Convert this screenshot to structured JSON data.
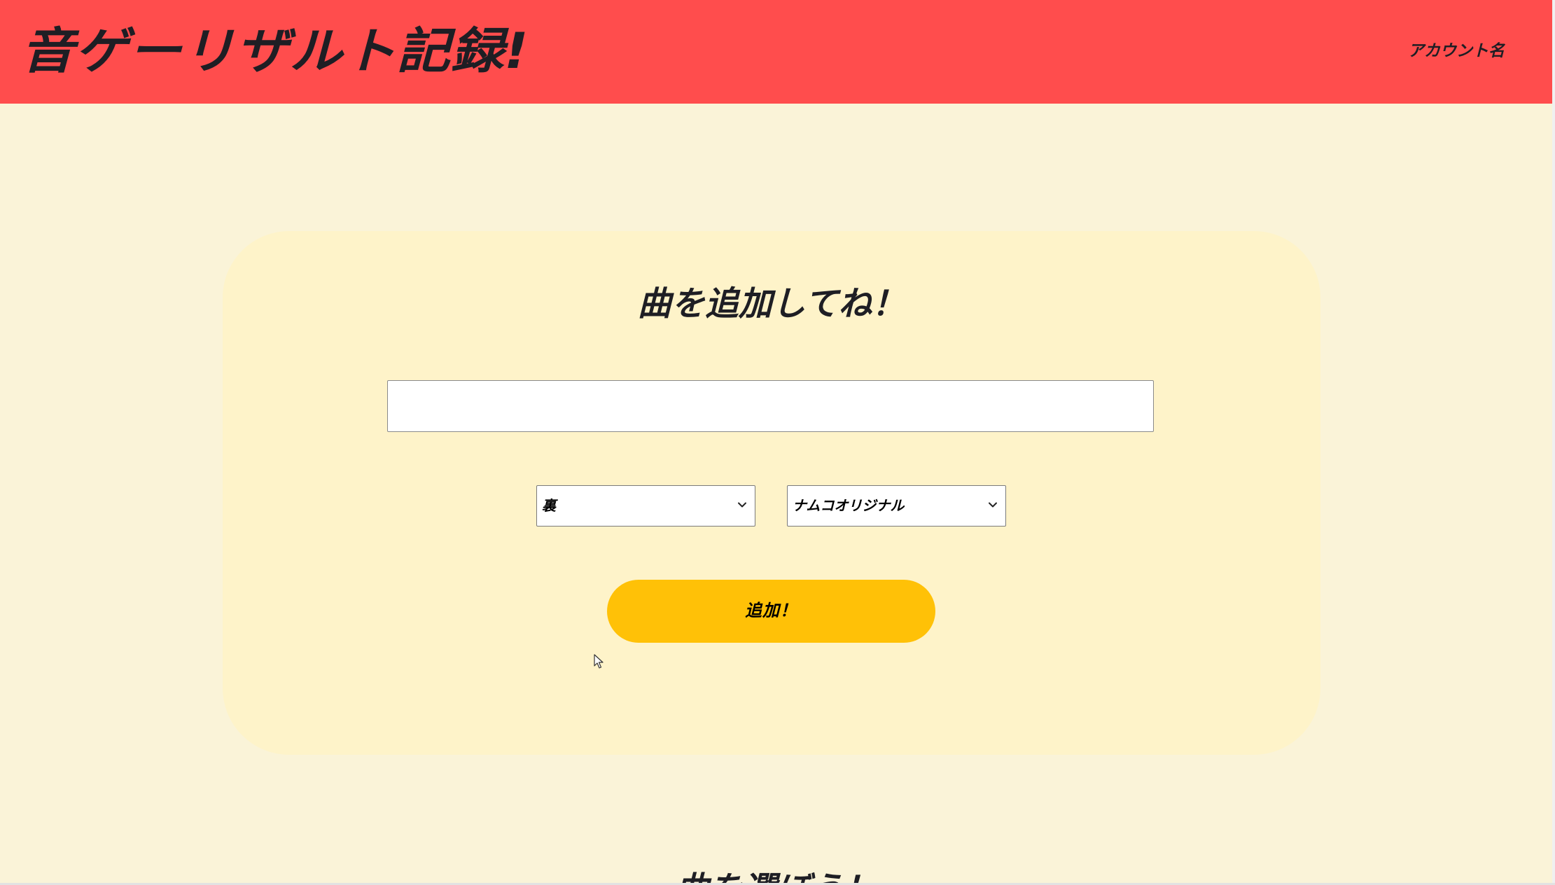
{
  "header": {
    "site_title": "音ゲーリザルト記録!",
    "account_name": "アカウント名"
  },
  "add_song_form": {
    "title": "曲を追加してね！",
    "song_input": {
      "value": "",
      "placeholder": ""
    },
    "difficulty_select": {
      "selected": "裏"
    },
    "genre_select": {
      "selected": "ナムコオリジナル"
    },
    "add_button_label": "追加！"
  },
  "next_section": {
    "title": "曲を選ぼう！"
  },
  "colors": {
    "header_bg": "#FF4D4D",
    "page_bg": "#FAF3D8",
    "card_bg": "#FEF3C9",
    "button_bg": "#FFC107",
    "text_dark": "#1e1e24"
  }
}
